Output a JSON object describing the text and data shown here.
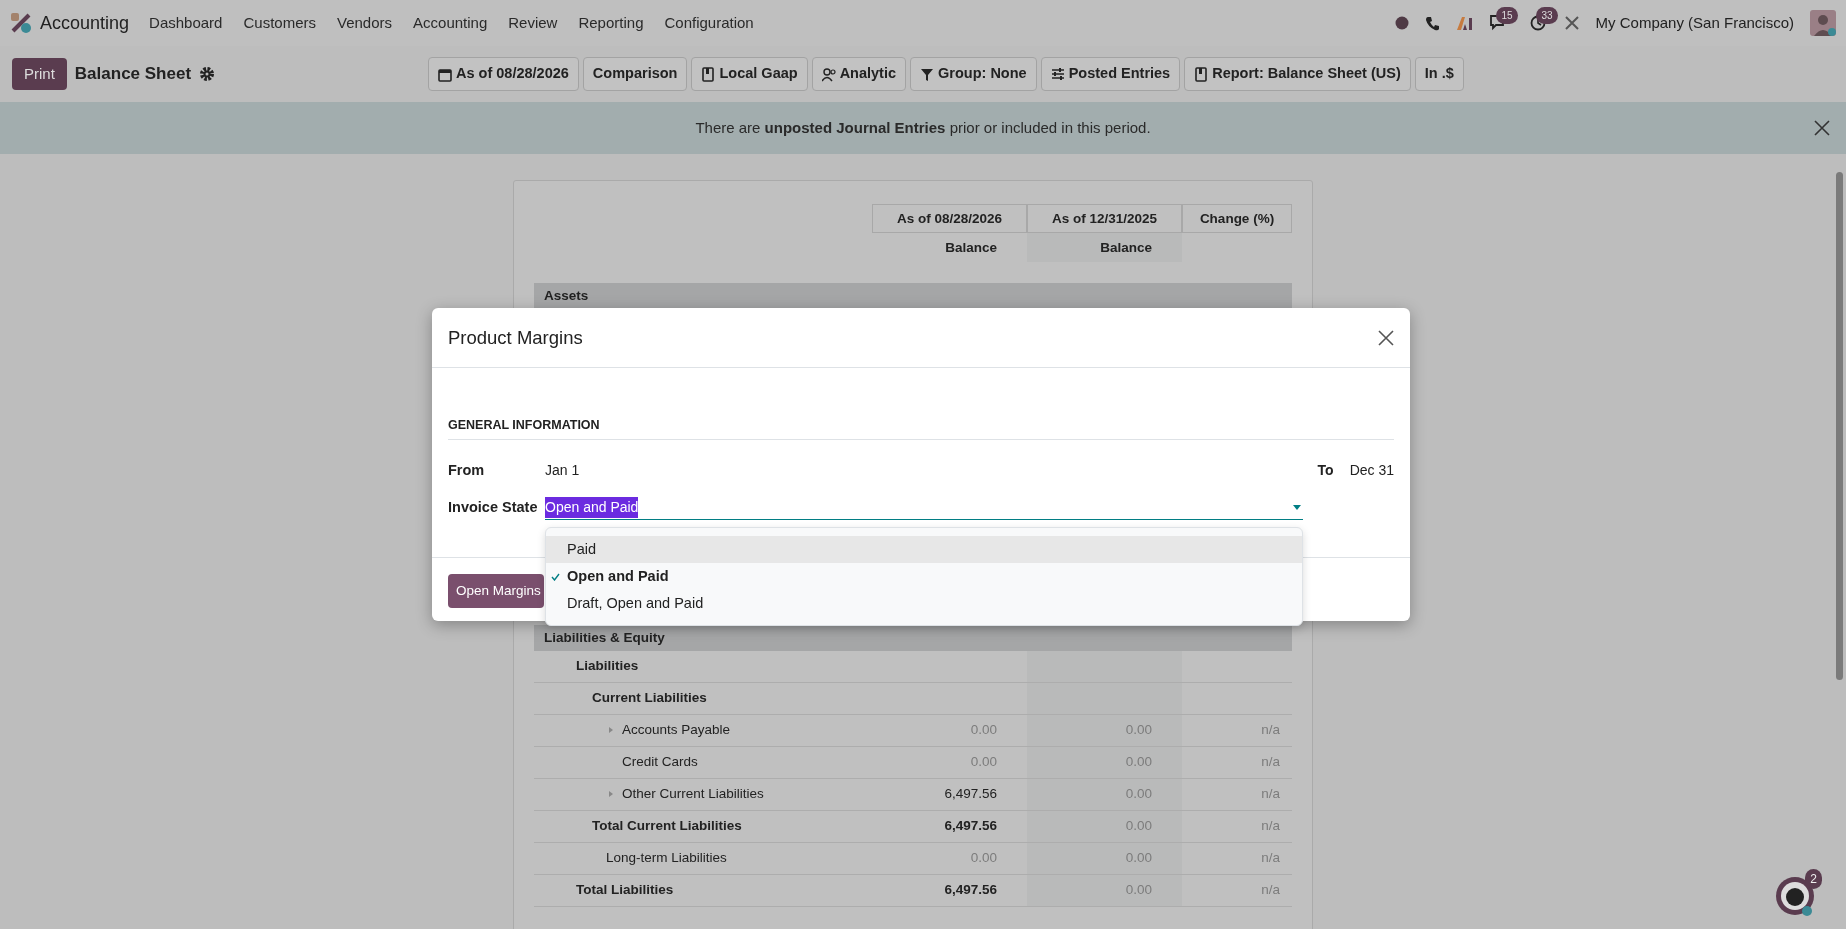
{
  "navbar": {
    "app": "Accounting",
    "menu": [
      "Dashboard",
      "Customers",
      "Vendors",
      "Accounting",
      "Review",
      "Reporting",
      "Configuration"
    ],
    "messages_badge": "15",
    "activities_badge": "33",
    "company": "My Company (San Francisco)"
  },
  "control_panel": {
    "print": "Print",
    "title": "Balance Sheet",
    "filters": [
      {
        "kind": "date",
        "label": "As of 08/28/2026"
      },
      {
        "kind": "plain",
        "label": "Comparison"
      },
      {
        "kind": "journal",
        "label": "Local Gaap"
      },
      {
        "kind": "analytic",
        "label": "Analytic"
      },
      {
        "kind": "grouping",
        "label": "Group: None"
      },
      {
        "kind": "options",
        "label": "Posted Entries"
      },
      {
        "kind": "journal",
        "label": "Report: Balance Sheet (US)"
      },
      {
        "kind": "plain",
        "label": "In .$"
      }
    ]
  },
  "alert": "There are **unposted Journal Entries** prior or included in this period.",
  "report": {
    "columns": [
      "As of 08/28/2026",
      "As of 12/31/2025",
      "Change (%)"
    ],
    "subheaders": [
      "Balance",
      "Balance"
    ],
    "lines": [
      {
        "label": "Assets",
        "kind": "section"
      },
      {
        "label": "Liabilities & Equity",
        "kind": "section",
        "children": [
          {
            "label": "Liabilities",
            "kind": "group",
            "children": [
              {
                "label": "Current Liabilities",
                "kind": "group",
                "children": [
                  {
                    "label": "Accounts Payable",
                    "kind": "line",
                    "expandable": true,
                    "cells": [
                      {
                        "text": "0.00",
                        "muted": true
                      },
                      {
                        "text": "0.00",
                        "muted": true
                      },
                      {
                        "text": "n/a",
                        "muted": true
                      }
                    ]
                  },
                  {
                    "label": "Credit Cards",
                    "kind": "line",
                    "expandable": false,
                    "cells": [
                      {
                        "text": "0.00",
                        "muted": true
                      },
                      {
                        "text": "0.00",
                        "muted": true
                      },
                      {
                        "text": "n/a",
                        "muted": true
                      }
                    ]
                  },
                  {
                    "label": "Other Current Liabilities",
                    "kind": "line",
                    "expandable": true,
                    "cells": [
                      {
                        "text": "6,497.56",
                        "muted": false
                      },
                      {
                        "text": "0.00",
                        "muted": true
                      },
                      {
                        "text": "n/a",
                        "muted": true
                      }
                    ]
                  }
                ]
              },
              {
                "label": "Total Current Liabilities",
                "kind": "total",
                "cells": [
                  {
                    "text": "6,497.56",
                    "muted": false
                  },
                  {
                    "text": "0.00",
                    "muted": true
                  },
                  {
                    "text": "n/a",
                    "muted": true
                  }
                ]
              },
              {
                "label": "Long-term Liabilities",
                "kind": "line",
                "expandable": false,
                "cells": [
                  {
                    "text": "0.00",
                    "muted": true
                  },
                  {
                    "text": "0.00",
                    "muted": true
                  },
                  {
                    "text": "n/a",
                    "muted": true
                  }
                ]
              }
            ]
          },
          {
            "label": "Total Liabilities",
            "kind": "total",
            "cells": [
              {
                "text": "6,497.56",
                "muted": false
              },
              {
                "text": "0.00",
                "muted": true
              },
              {
                "text": "n/a",
                "muted": true
              }
            ]
          }
        ]
      }
    ]
  },
  "dialog": {
    "title": "Product Margins",
    "section": "GENERAL INFORMATION",
    "from_label": "From",
    "from_value": "Jan 1",
    "to_label": "To",
    "to_value": "Dec 31",
    "state_label": "Invoice State",
    "state_value": "Open and Paid",
    "options": [
      {
        "label": "Paid",
        "selected": false,
        "highlighted": true
      },
      {
        "label": "Open and Paid",
        "selected": true,
        "highlighted": false
      },
      {
        "label": "Draft, Open and Paid",
        "selected": false,
        "highlighted": false
      }
    ],
    "button": "Open Margins"
  },
  "chat": {
    "badge": "2"
  }
}
